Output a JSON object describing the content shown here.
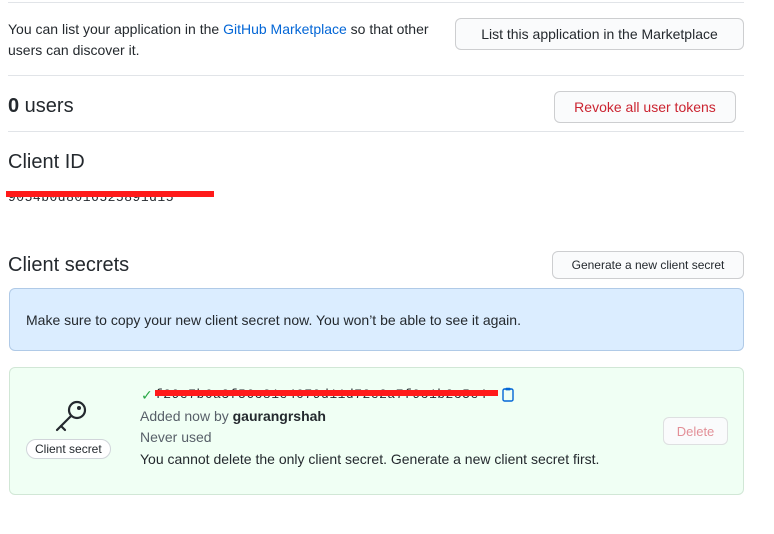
{
  "marketplace": {
    "text_before": "You can list your application in the ",
    "link": "GitHub Marketplace",
    "text_after": " so that other users can discover it.",
    "button_label": "List this application in the Marketplace"
  },
  "users": {
    "count": "0",
    "label": " users",
    "revoke_label": "Revoke all user tokens"
  },
  "client_id": {
    "title": "Client ID",
    "value": "9054b0d8016525891d15"
  },
  "client_secrets": {
    "title": "Client secrets",
    "generate_label": "Generate a new client secret",
    "flash": "Make sure to copy your new client secret now. You won’t be able to see it again.",
    "secret": {
      "label": "Client secret",
      "value": "f29e7b6a3f56c81e4079d11d72e2a7f9c1b2c5e4",
      "added_prefix": "Added now by ",
      "added_by": "gaurangrshah",
      "usage": "Never used",
      "warning": "You cannot delete the only client secret. Generate a new client secret first.",
      "delete_label": "Delete"
    }
  },
  "colors": {
    "link": "#0366d6",
    "danger": "#cb2431",
    "success": "#28a745",
    "flash_bg": "#dbedff",
    "secret_bg": "#f0fff4",
    "redaction": "#ff1a1a"
  },
  "icons": {
    "key": "key-icon",
    "check": "check-icon",
    "copy": "copy-icon"
  }
}
